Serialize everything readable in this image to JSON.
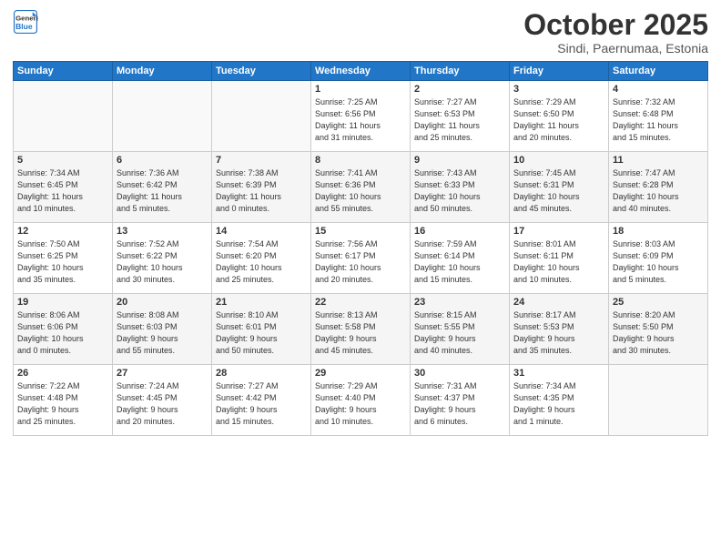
{
  "header": {
    "logo_line1": "General",
    "logo_line2": "Blue",
    "month": "October 2025",
    "location": "Sindi, Paernumaa, Estonia"
  },
  "weekdays": [
    "Sunday",
    "Monday",
    "Tuesday",
    "Wednesday",
    "Thursday",
    "Friday",
    "Saturday"
  ],
  "weeks": [
    [
      {
        "day": "",
        "info": ""
      },
      {
        "day": "",
        "info": ""
      },
      {
        "day": "",
        "info": ""
      },
      {
        "day": "1",
        "info": "Sunrise: 7:25 AM\nSunset: 6:56 PM\nDaylight: 11 hours\nand 31 minutes."
      },
      {
        "day": "2",
        "info": "Sunrise: 7:27 AM\nSunset: 6:53 PM\nDaylight: 11 hours\nand 25 minutes."
      },
      {
        "day": "3",
        "info": "Sunrise: 7:29 AM\nSunset: 6:50 PM\nDaylight: 11 hours\nand 20 minutes."
      },
      {
        "day": "4",
        "info": "Sunrise: 7:32 AM\nSunset: 6:48 PM\nDaylight: 11 hours\nand 15 minutes."
      }
    ],
    [
      {
        "day": "5",
        "info": "Sunrise: 7:34 AM\nSunset: 6:45 PM\nDaylight: 11 hours\nand 10 minutes."
      },
      {
        "day": "6",
        "info": "Sunrise: 7:36 AM\nSunset: 6:42 PM\nDaylight: 11 hours\nand 5 minutes."
      },
      {
        "day": "7",
        "info": "Sunrise: 7:38 AM\nSunset: 6:39 PM\nDaylight: 11 hours\nand 0 minutes."
      },
      {
        "day": "8",
        "info": "Sunrise: 7:41 AM\nSunset: 6:36 PM\nDaylight: 10 hours\nand 55 minutes."
      },
      {
        "day": "9",
        "info": "Sunrise: 7:43 AM\nSunset: 6:33 PM\nDaylight: 10 hours\nand 50 minutes."
      },
      {
        "day": "10",
        "info": "Sunrise: 7:45 AM\nSunset: 6:31 PM\nDaylight: 10 hours\nand 45 minutes."
      },
      {
        "day": "11",
        "info": "Sunrise: 7:47 AM\nSunset: 6:28 PM\nDaylight: 10 hours\nand 40 minutes."
      }
    ],
    [
      {
        "day": "12",
        "info": "Sunrise: 7:50 AM\nSunset: 6:25 PM\nDaylight: 10 hours\nand 35 minutes."
      },
      {
        "day": "13",
        "info": "Sunrise: 7:52 AM\nSunset: 6:22 PM\nDaylight: 10 hours\nand 30 minutes."
      },
      {
        "day": "14",
        "info": "Sunrise: 7:54 AM\nSunset: 6:20 PM\nDaylight: 10 hours\nand 25 minutes."
      },
      {
        "day": "15",
        "info": "Sunrise: 7:56 AM\nSunset: 6:17 PM\nDaylight: 10 hours\nand 20 minutes."
      },
      {
        "day": "16",
        "info": "Sunrise: 7:59 AM\nSunset: 6:14 PM\nDaylight: 10 hours\nand 15 minutes."
      },
      {
        "day": "17",
        "info": "Sunrise: 8:01 AM\nSunset: 6:11 PM\nDaylight: 10 hours\nand 10 minutes."
      },
      {
        "day": "18",
        "info": "Sunrise: 8:03 AM\nSunset: 6:09 PM\nDaylight: 10 hours\nand 5 minutes."
      }
    ],
    [
      {
        "day": "19",
        "info": "Sunrise: 8:06 AM\nSunset: 6:06 PM\nDaylight: 10 hours\nand 0 minutes."
      },
      {
        "day": "20",
        "info": "Sunrise: 8:08 AM\nSunset: 6:03 PM\nDaylight: 9 hours\nand 55 minutes."
      },
      {
        "day": "21",
        "info": "Sunrise: 8:10 AM\nSunset: 6:01 PM\nDaylight: 9 hours\nand 50 minutes."
      },
      {
        "day": "22",
        "info": "Sunrise: 8:13 AM\nSunset: 5:58 PM\nDaylight: 9 hours\nand 45 minutes."
      },
      {
        "day": "23",
        "info": "Sunrise: 8:15 AM\nSunset: 5:55 PM\nDaylight: 9 hours\nand 40 minutes."
      },
      {
        "day": "24",
        "info": "Sunrise: 8:17 AM\nSunset: 5:53 PM\nDaylight: 9 hours\nand 35 minutes."
      },
      {
        "day": "25",
        "info": "Sunrise: 8:20 AM\nSunset: 5:50 PM\nDaylight: 9 hours\nand 30 minutes."
      }
    ],
    [
      {
        "day": "26",
        "info": "Sunrise: 7:22 AM\nSunset: 4:48 PM\nDaylight: 9 hours\nand 25 minutes."
      },
      {
        "day": "27",
        "info": "Sunrise: 7:24 AM\nSunset: 4:45 PM\nDaylight: 9 hours\nand 20 minutes."
      },
      {
        "day": "28",
        "info": "Sunrise: 7:27 AM\nSunset: 4:42 PM\nDaylight: 9 hours\nand 15 minutes."
      },
      {
        "day": "29",
        "info": "Sunrise: 7:29 AM\nSunset: 4:40 PM\nDaylight: 9 hours\nand 10 minutes."
      },
      {
        "day": "30",
        "info": "Sunrise: 7:31 AM\nSunset: 4:37 PM\nDaylight: 9 hours\nand 6 minutes."
      },
      {
        "day": "31",
        "info": "Sunrise: 7:34 AM\nSunset: 4:35 PM\nDaylight: 9 hours\nand 1 minute."
      },
      {
        "day": "",
        "info": ""
      }
    ]
  ]
}
